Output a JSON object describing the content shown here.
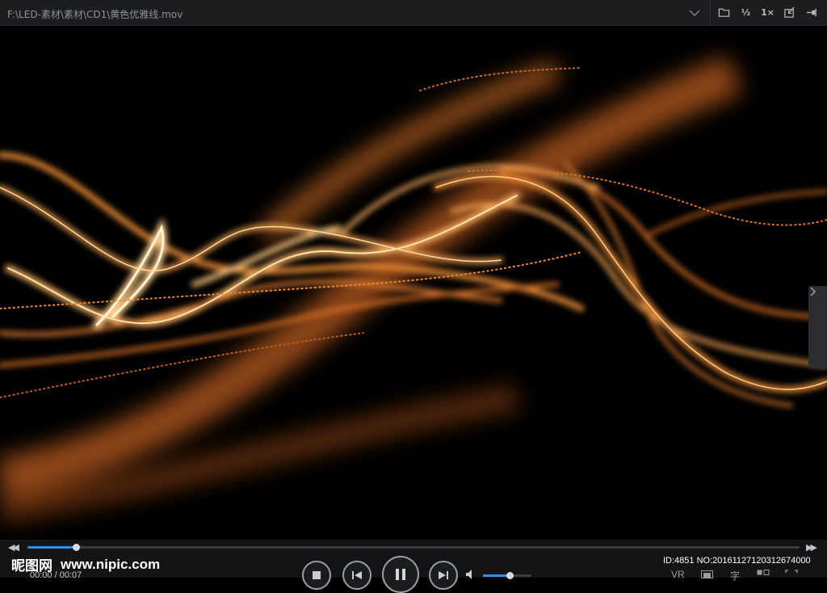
{
  "titlebar": {
    "path": "F:\\LED-素材\\素材\\CD1\\黄色优雅线.mov",
    "toolbar": {
      "half_label": "½",
      "speed_label": "1×"
    }
  },
  "player": {
    "time": "00:00 / 00:07",
    "progress_fraction": 0.063,
    "volume_fraction": 0.55,
    "accent_color": "#2f8fea",
    "right_buttons": {
      "vr": "VR",
      "subtitle": "字"
    }
  },
  "watermark": {
    "name": "昵图网",
    "url": "www.nipic.com",
    "id_text": "ID:4851 NO:20161127120312674000"
  }
}
